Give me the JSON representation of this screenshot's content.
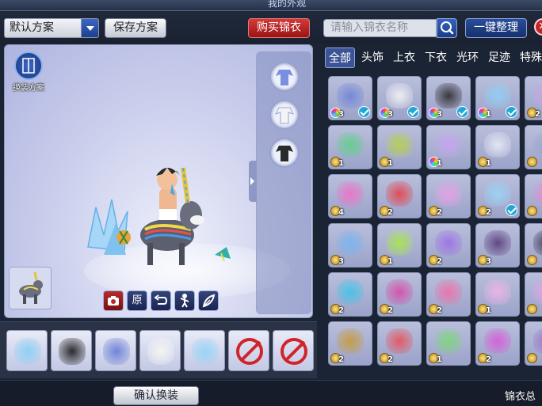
{
  "window": {
    "title": "我的外观"
  },
  "toolbar": {
    "scheme_value": "默认方案",
    "save_label": "保存方案",
    "buy_label": "购买锦衣",
    "search_placeholder": "请输入锦衣名称",
    "organize_label": "一键整理"
  },
  "preview": {
    "scheme_button_label": "换装方案",
    "action_original_label": "原"
  },
  "tabs": [
    "全部",
    "头饰",
    "上衣",
    "下衣",
    "光环",
    "足迹",
    "特殊"
  ],
  "active_tab": "全部",
  "grid": {
    "rows": [
      [
        {
          "count": "3",
          "coin": "rainbow",
          "checked": true,
          "icon": "blue-robe-icon",
          "color": "#6f84d8"
        },
        {
          "count": "3",
          "coin": "rainbow",
          "checked": true,
          "icon": "white-shorts-icon",
          "color": "#f4f4f4"
        },
        {
          "count": "3",
          "coin": "rainbow",
          "checked": true,
          "icon": "black-hair-icon",
          "color": "#2b2b2b"
        },
        {
          "count": "1",
          "coin": "rainbow",
          "checked": true,
          "icon": "blue-wings-icon",
          "color": "#8fcff5"
        },
        {
          "count": "2",
          "coin": "gold",
          "checked": false,
          "icon": "partial-item-icon",
          "color": "#c9a4e8"
        }
      ],
      [
        {
          "count": "1",
          "coin": "gold",
          "checked": false,
          "icon": "green-fish-icon",
          "color": "#5fd08a"
        },
        {
          "count": "1",
          "coin": "gold",
          "checked": false,
          "icon": "black-hole-icon",
          "color": "#b7d14a"
        },
        {
          "count": "1",
          "coin": "rainbow",
          "checked": false,
          "icon": "purple-sparkle-icon",
          "color": "#c8a4f2"
        },
        {
          "count": "1",
          "coin": "gold",
          "checked": false,
          "icon": "white-figure-icon",
          "color": "#e8ecf6"
        },
        {
          "count": "",
          "coin": "gold",
          "checked": false,
          "icon": "partial-item-icon",
          "color": "#9aa4cf"
        }
      ],
      [
        {
          "count": "4",
          "coin": "gold",
          "checked": false,
          "icon": "pink-trail-icon",
          "color": "#f06fc9"
        },
        {
          "count": "2",
          "coin": "gold",
          "checked": false,
          "icon": "red-burst-icon",
          "color": "#e8414a"
        },
        {
          "count": "2",
          "coin": "gold",
          "checked": false,
          "icon": "pink-octopus-icon",
          "color": "#e8a0e8"
        },
        {
          "count": "2",
          "coin": "gold",
          "checked": true,
          "icon": "ice-wings-icon",
          "color": "#9ad4f6"
        },
        {
          "count": "",
          "coin": "gold",
          "checked": false,
          "icon": "partial-item-icon",
          "color": "#e58ad6"
        }
      ],
      [
        {
          "count": "3",
          "coin": "gold",
          "checked": false,
          "icon": "blue-streak-icon",
          "color": "#78b4f0"
        },
        {
          "count": "1",
          "coin": "gold",
          "checked": false,
          "icon": "green-bubbles-icon",
          "color": "#a8e84a"
        },
        {
          "count": "2",
          "coin": "gold",
          "checked": false,
          "icon": "purple-swirl-icon",
          "color": "#9d6fe8"
        },
        {
          "count": "3",
          "coin": "gold",
          "checked": false,
          "icon": "purple-hair-icon",
          "color": "#5a3b7a"
        },
        {
          "count": "",
          "coin": "gold",
          "checked": false,
          "icon": "partial-item-icon",
          "color": "#3a3050"
        }
      ],
      [
        {
          "count": "2",
          "coin": "gold",
          "checked": false,
          "icon": "cyan-wings-icon",
          "color": "#3fc4e8"
        },
        {
          "count": "2",
          "coin": "gold",
          "checked": false,
          "icon": "lotus-icon",
          "color": "#d84aa8"
        },
        {
          "count": "2",
          "coin": "gold",
          "checked": false,
          "icon": "pink-beam-icon",
          "color": "#f06fa8"
        },
        {
          "count": "1",
          "coin": "gold",
          "checked": false,
          "icon": "pink-cloud-icon",
          "color": "#f0b4e8"
        },
        {
          "count": "",
          "coin": "gold",
          "checked": false,
          "icon": "partial-item-icon",
          "color": "#e8a0f0"
        }
      ],
      [
        {
          "count": "2",
          "coin": "gold",
          "checked": false,
          "icon": "golden-mask-icon",
          "color": "#c89a3a"
        },
        {
          "count": "2",
          "coin": "gold",
          "checked": false,
          "icon": "red-hair-icon",
          "color": "#e8505a"
        },
        {
          "count": "1",
          "coin": "gold",
          "checked": false,
          "icon": "green-bird-icon",
          "color": "#7ad87a"
        },
        {
          "count": "2",
          "coin": "gold",
          "checked": false,
          "icon": "colorful-dots-icon",
          "color": "#d85ad8"
        },
        {
          "count": "",
          "coin": "gold",
          "checked": false,
          "icon": "partial-item-icon",
          "color": "#9a6fc8"
        }
      ]
    ]
  },
  "equipped_slots": [
    {
      "icon": "blue-wings-icon",
      "color": "#8fcff5",
      "empty": false
    },
    {
      "icon": "black-hair-icon",
      "color": "#2b2b2b",
      "empty": false
    },
    {
      "icon": "blue-robe-icon",
      "color": "#6f84d8",
      "empty": false
    },
    {
      "icon": "white-shorts-icon",
      "color": "#f4f4f4",
      "empty": false
    },
    {
      "icon": "ice-wings-icon",
      "color": "#9ad4f6",
      "empty": false
    },
    {
      "icon": "prohibited-icon",
      "color": "#d0242c",
      "empty": true
    },
    {
      "icon": "prohibited-icon",
      "color": "#d0242c",
      "empty": true
    }
  ],
  "bottom": {
    "confirm_label": "确认换装",
    "total_label": "锦衣总"
  },
  "colors": {
    "accent_blue": "#3c5496",
    "buy_red": "#c2262d",
    "check_cyan": "#20a7d6"
  }
}
